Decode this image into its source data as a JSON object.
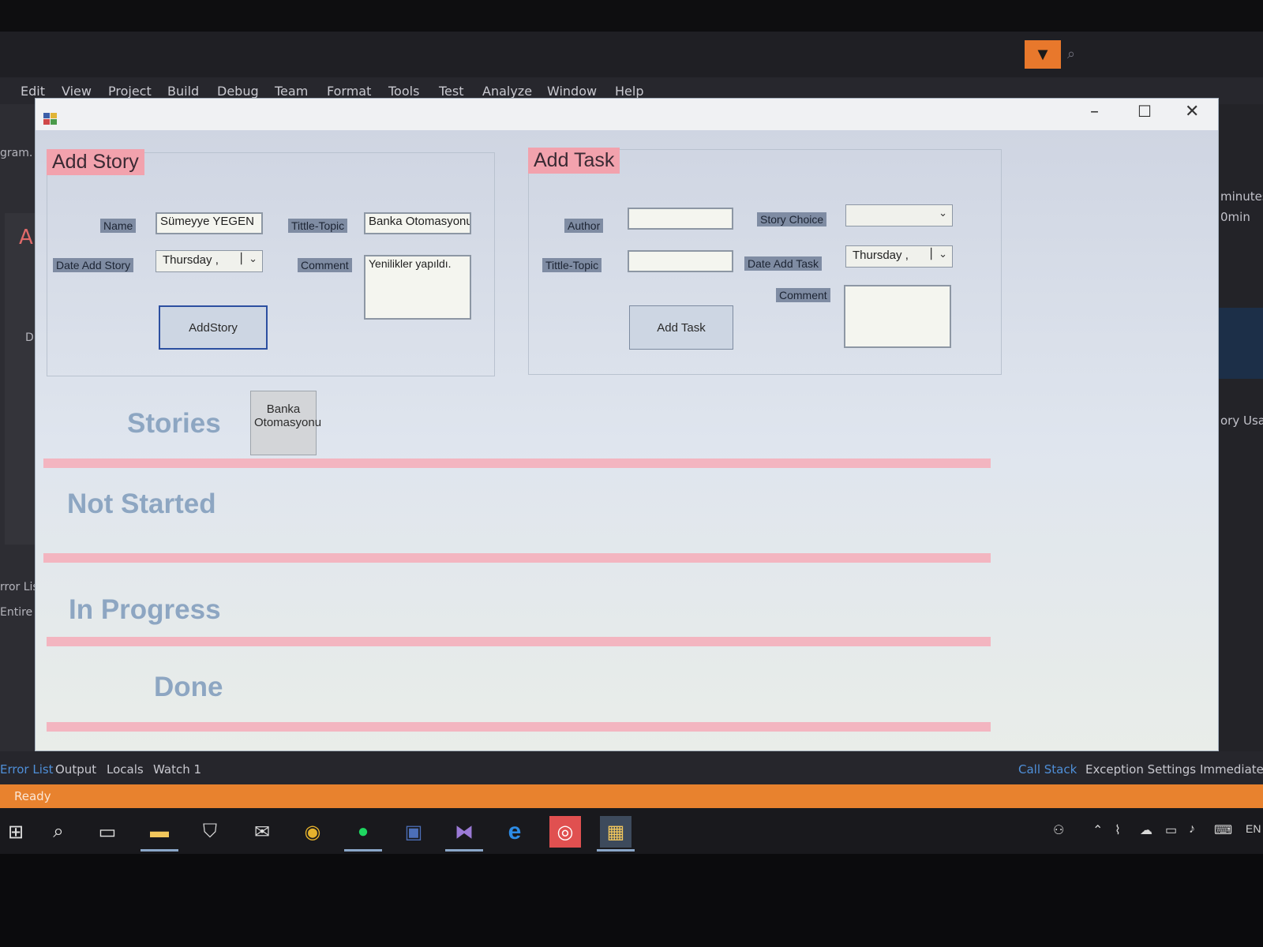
{
  "ide": {
    "menu": [
      "Edit",
      "View",
      "Project",
      "Build",
      "Debug",
      "Team",
      "Format",
      "Tools",
      "Test",
      "Analyze",
      "Window",
      "Help"
    ],
    "left_panel": {
      "program_tab": "gram.",
      "doc_letter": "A",
      "doc_letter2": "D",
      "error_list": "rror List",
      "entire": "Entire S"
    },
    "right_panel": {
      "minutes": "minutes",
      "min": "0min",
      "memory_usage": "ory Usag"
    },
    "bottom_tabs_left": [
      "Error List",
      "Output",
      "Locals",
      "Watch 1"
    ],
    "bottom_tabs_right": [
      "Call Stack",
      "Exception Settings",
      "Immediate"
    ],
    "status": "Ready"
  },
  "form": {
    "add_story": {
      "title": "Add Story",
      "name_label": "Name",
      "name_value": "Sümeyye YEGEN",
      "topic_label": "Tittle-Topic",
      "topic_value": "Banka  Otomasyonu",
      "date_label": "Date Add Story",
      "date_value": "Thursday  ,",
      "comment_label": "Comment",
      "comment_value": "Yenilikler yapıldı.",
      "button_label": "AddStory"
    },
    "add_task": {
      "title": "Add Task",
      "author_label": "Author",
      "author_value": "",
      "story_choice_label": "Story Choice",
      "story_choice_value": "",
      "topic_label": "Tittle-Topic",
      "topic_value": "",
      "date_label": "Date Add Task",
      "date_value": "Thursday  ,",
      "comment_label": "Comment",
      "comment_value": "",
      "button_label": "Add Task"
    },
    "lanes": {
      "stories": "Stories",
      "not_started": "Not Started",
      "in_progress": "In Progress",
      "done": "Done"
    },
    "story_cards": [
      "Banka Otomasyonu"
    ]
  },
  "taskbar": {
    "tray_language": "EN"
  },
  "colors": {
    "accent_orange": "#e8822e",
    "group_title_pink": "#f2a2ad",
    "divider_pink": "#f3b5c0",
    "lane_title_blue": "#8da6c2"
  }
}
